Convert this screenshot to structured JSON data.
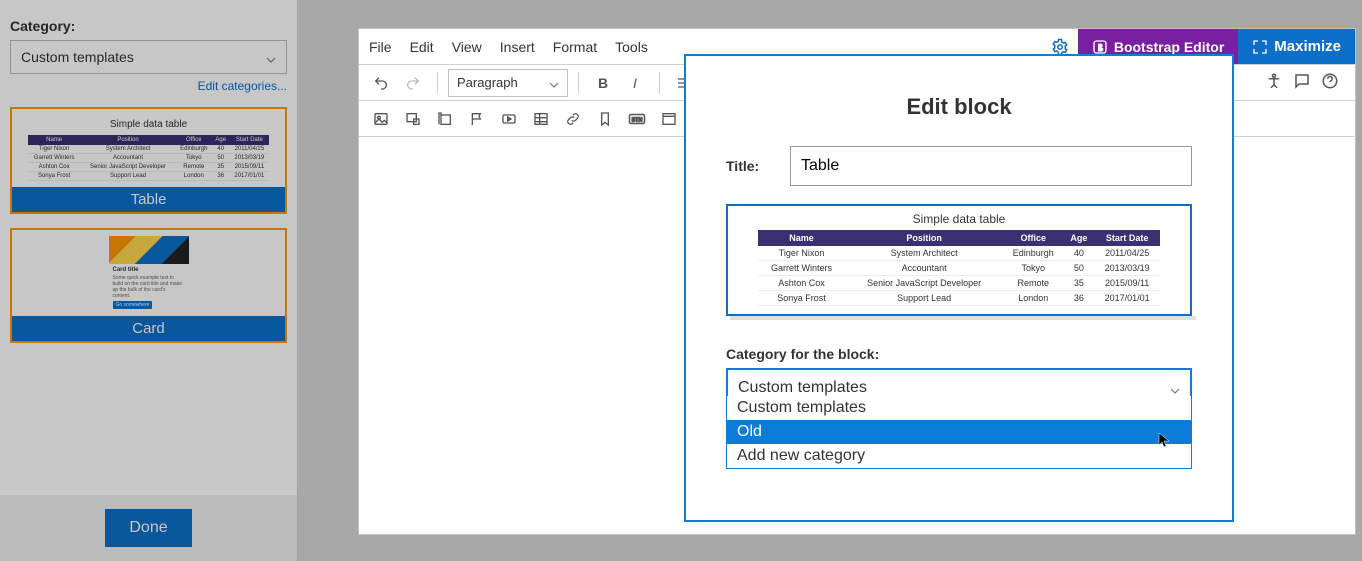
{
  "left_panel": {
    "category_label": "Category:",
    "selected_category": "Custom templates",
    "edit_categories": "Edit categories...",
    "templates": [
      {
        "label": "Table"
      },
      {
        "label": "Card"
      }
    ],
    "done_label": "Done"
  },
  "preview_table": {
    "title": "Simple data table",
    "columns": [
      "Name",
      "Position",
      "Office",
      "Age",
      "Start Date"
    ],
    "rows": [
      [
        "Tiger Nixon",
        "System Architect",
        "Edinburgh",
        "40",
        "2011/04/25"
      ],
      [
        "Garrett Winters",
        "Accountant",
        "Tokyo",
        "50",
        "2013/03/19"
      ],
      [
        "Ashton Cox",
        "Senior JavaScript Developer",
        "Remote",
        "35",
        "2015/09/11"
      ],
      [
        "Sonya Frost",
        "Support Lead",
        "London",
        "36",
        "2017/01/01"
      ]
    ]
  },
  "card_preview": {
    "title": "Card title",
    "body": "Some quick example text to build on the card title and make up the bulk of the card's content.",
    "button": "Go somewhere"
  },
  "editor": {
    "menu": [
      "File",
      "Edit",
      "View",
      "Insert",
      "Format",
      "Tools"
    ],
    "bootstrap_label": "Bootstrap Editor",
    "maximize_label": "Maximize",
    "paragraph_dd": "Paragraph"
  },
  "dialog": {
    "title": "Edit block",
    "title_label": "Title:",
    "title_value": "Table",
    "category_label": "Category for the block:",
    "selected_category": "Custom templates",
    "options": [
      "Custom templates",
      "Old",
      "Add new category"
    ],
    "highlighted_option_index": 1
  }
}
